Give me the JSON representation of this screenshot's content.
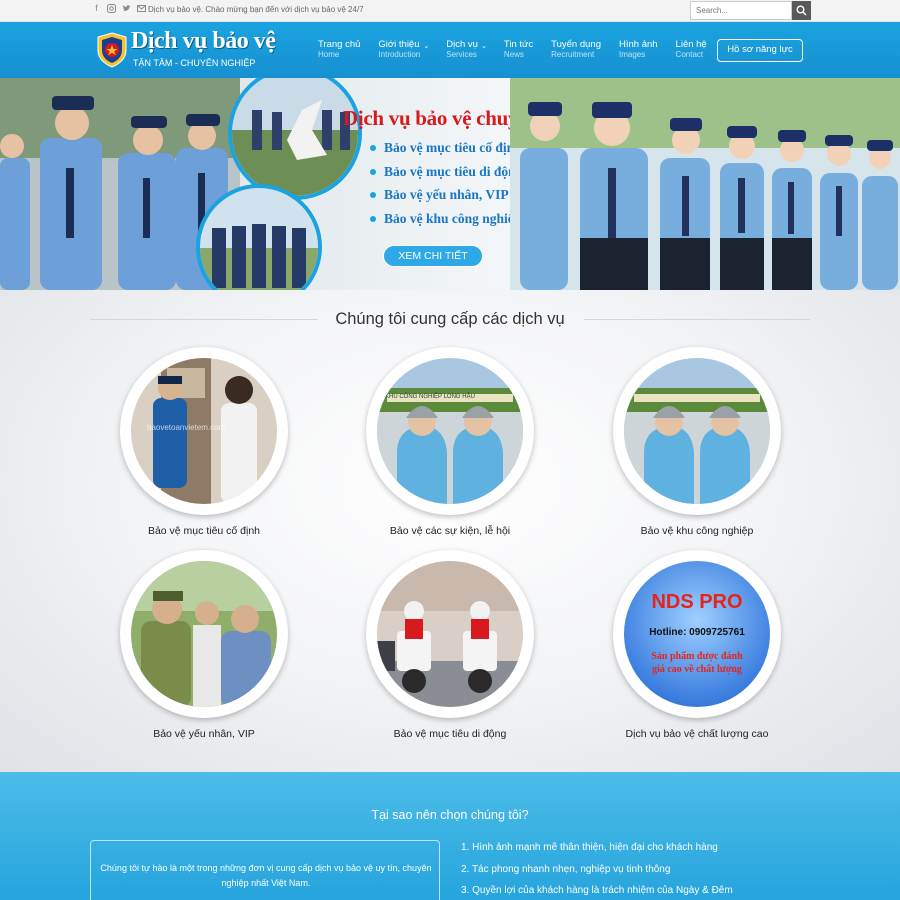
{
  "topbar": {
    "tagline": "Dịch vụ bảo vệ. Chào mừng bạn đến với dịch vụ bảo vệ 24/7",
    "search_placeholder": "Search...",
    "social_icons": [
      "facebook-icon",
      "instagram-icon",
      "twitter-icon",
      "email-icon"
    ]
  },
  "header": {
    "logo_title": "Dịch vụ bảo vệ",
    "logo_subtitle": "TẬN TÂM - CHUYÊN NGHIỆP",
    "nav": [
      {
        "label": "Trang chủ",
        "sub": "Home"
      },
      {
        "label": "Giới thiệu",
        "sub": "Introduction"
      },
      {
        "label": "Dịch vụ",
        "sub": "Services"
      },
      {
        "label": "Tin tức",
        "sub": "News"
      },
      {
        "label": "Tuyển dụng",
        "sub": "Recruitment"
      },
      {
        "label": "Hình ảnh",
        "sub": "Images"
      },
      {
        "label": "Liên hệ",
        "sub": "Contact"
      }
    ],
    "profile_button": "Hồ sơ năng lực"
  },
  "banner": {
    "title": "Dịch vụ bảo vệ chuyên nghiệp",
    "items": [
      "Bảo vệ mục tiêu cố định",
      "Bảo vệ mục tiêu di động",
      "Bảo vệ yếu nhân, VIP",
      "Bảo vệ khu công nghiệp"
    ],
    "cta": "XEM CHI TIẾT"
  },
  "services": {
    "title": "Chúng tôi cung cấp các dịch vụ",
    "items": [
      {
        "label": "Bảo vệ mục tiêu cố định"
      },
      {
        "label": "Bảo vệ các sự kiện, lễ hội"
      },
      {
        "label": "Bảo vệ khu công nghiệp"
      },
      {
        "label": "Bảo vệ yếu nhân, VIP"
      },
      {
        "label": "Bảo vệ mục tiêu di động"
      },
      {
        "label": "Dịch vụ bảo vệ chất lượng cao"
      }
    ],
    "watermark": "baovetoanvietem.com",
    "gate_sign": "KHU CÔNG NGHIỆP LONG HẬU",
    "promo": {
      "brand": "NDS PRO",
      "hotline": "Hotline: 0909725761",
      "slogan_1": "Sản phẩm được đánh",
      "slogan_2": "giá cao về chất lượng"
    }
  },
  "why": {
    "title": "Tại sao nên chọn chúng tôi?",
    "intro": "Chúng tôi tự hào là một trong những đơn vị cung cấp dịch vụ bảo vệ uy tín, chuyên nghiệp nhất Việt Nam.",
    "points": [
      "1. Hình ảnh mạnh mẽ thân thiện, hiện đại cho khách hàng",
      "2. Tác phong nhanh nhẹn, nghiệp vụ tinh thông",
      "3. Quyền lợi của khách hàng là trách nhiệm của Ngày & Đêm"
    ]
  }
}
